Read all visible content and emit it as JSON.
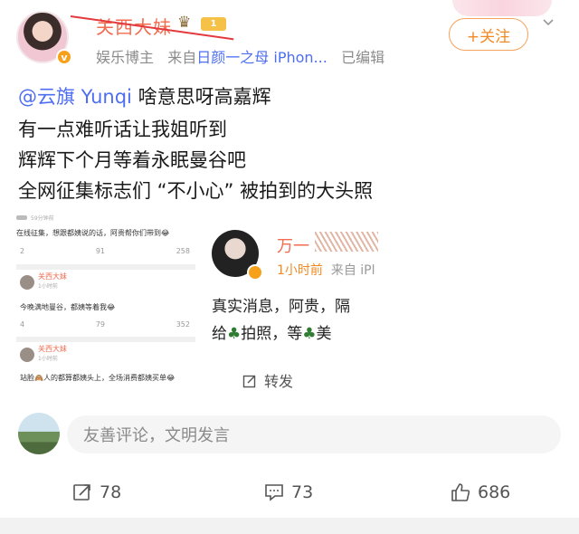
{
  "header": {
    "username": "关西大妹",
    "level": "1",
    "tag": "娱乐博主",
    "from_label": "来自",
    "source": "日颜一之母 iPhon...",
    "edited": "已编辑",
    "follow_label": "+关注"
  },
  "post": {
    "line1_mention": "@云旗 Yunqi",
    "line1_text": " 啥意思呀高嘉辉",
    "line2": "有一点难听话让我姐听到",
    "line3": "辉辉下个月等着永眠曼谷吧",
    "line4": "全网征集标志们 “不小心” 被拍到的大头照"
  },
  "collage": {
    "mini1": {
      "sub": "59分钟前",
      "text": "在线征集，想跟都姨说的话，阿贵帮你们带到😂",
      "reposts": "2",
      "comments": "91",
      "likes": "258"
    },
    "mini2": {
      "name": "关西大妹",
      "sub": "1小时前",
      "text": "今晚满地曼谷，都姨等着我😂",
      "reposts": "4",
      "comments": "79",
      "likes": "352"
    },
    "mini3": {
      "name": "关西大妹",
      "sub": "1小时前",
      "text": "站脸🙈人的都算都姨头上，全场消费都姨买单😂"
    },
    "card": {
      "name": "万一",
      "time": "1小时前",
      "from": "来自 iPl",
      "line1": "真实消息，阿贵，隔",
      "line2_a": "给",
      "line2_b": "拍照，等",
      "line2_c": "美",
      "repost": "转发"
    }
  },
  "comment": {
    "placeholder": "友善评论，文明发言"
  },
  "actions": {
    "reposts": "78",
    "comments": "73",
    "likes": "686"
  },
  "colors": {
    "username": "#f26c4f",
    "link": "#4e6ef2",
    "follow": "#f08a24"
  },
  "icons": [
    "crown-icon",
    "verified-badge-icon",
    "chevron-down-icon",
    "repost-icon",
    "comment-icon",
    "like-icon",
    "broccoli-emoji"
  ]
}
